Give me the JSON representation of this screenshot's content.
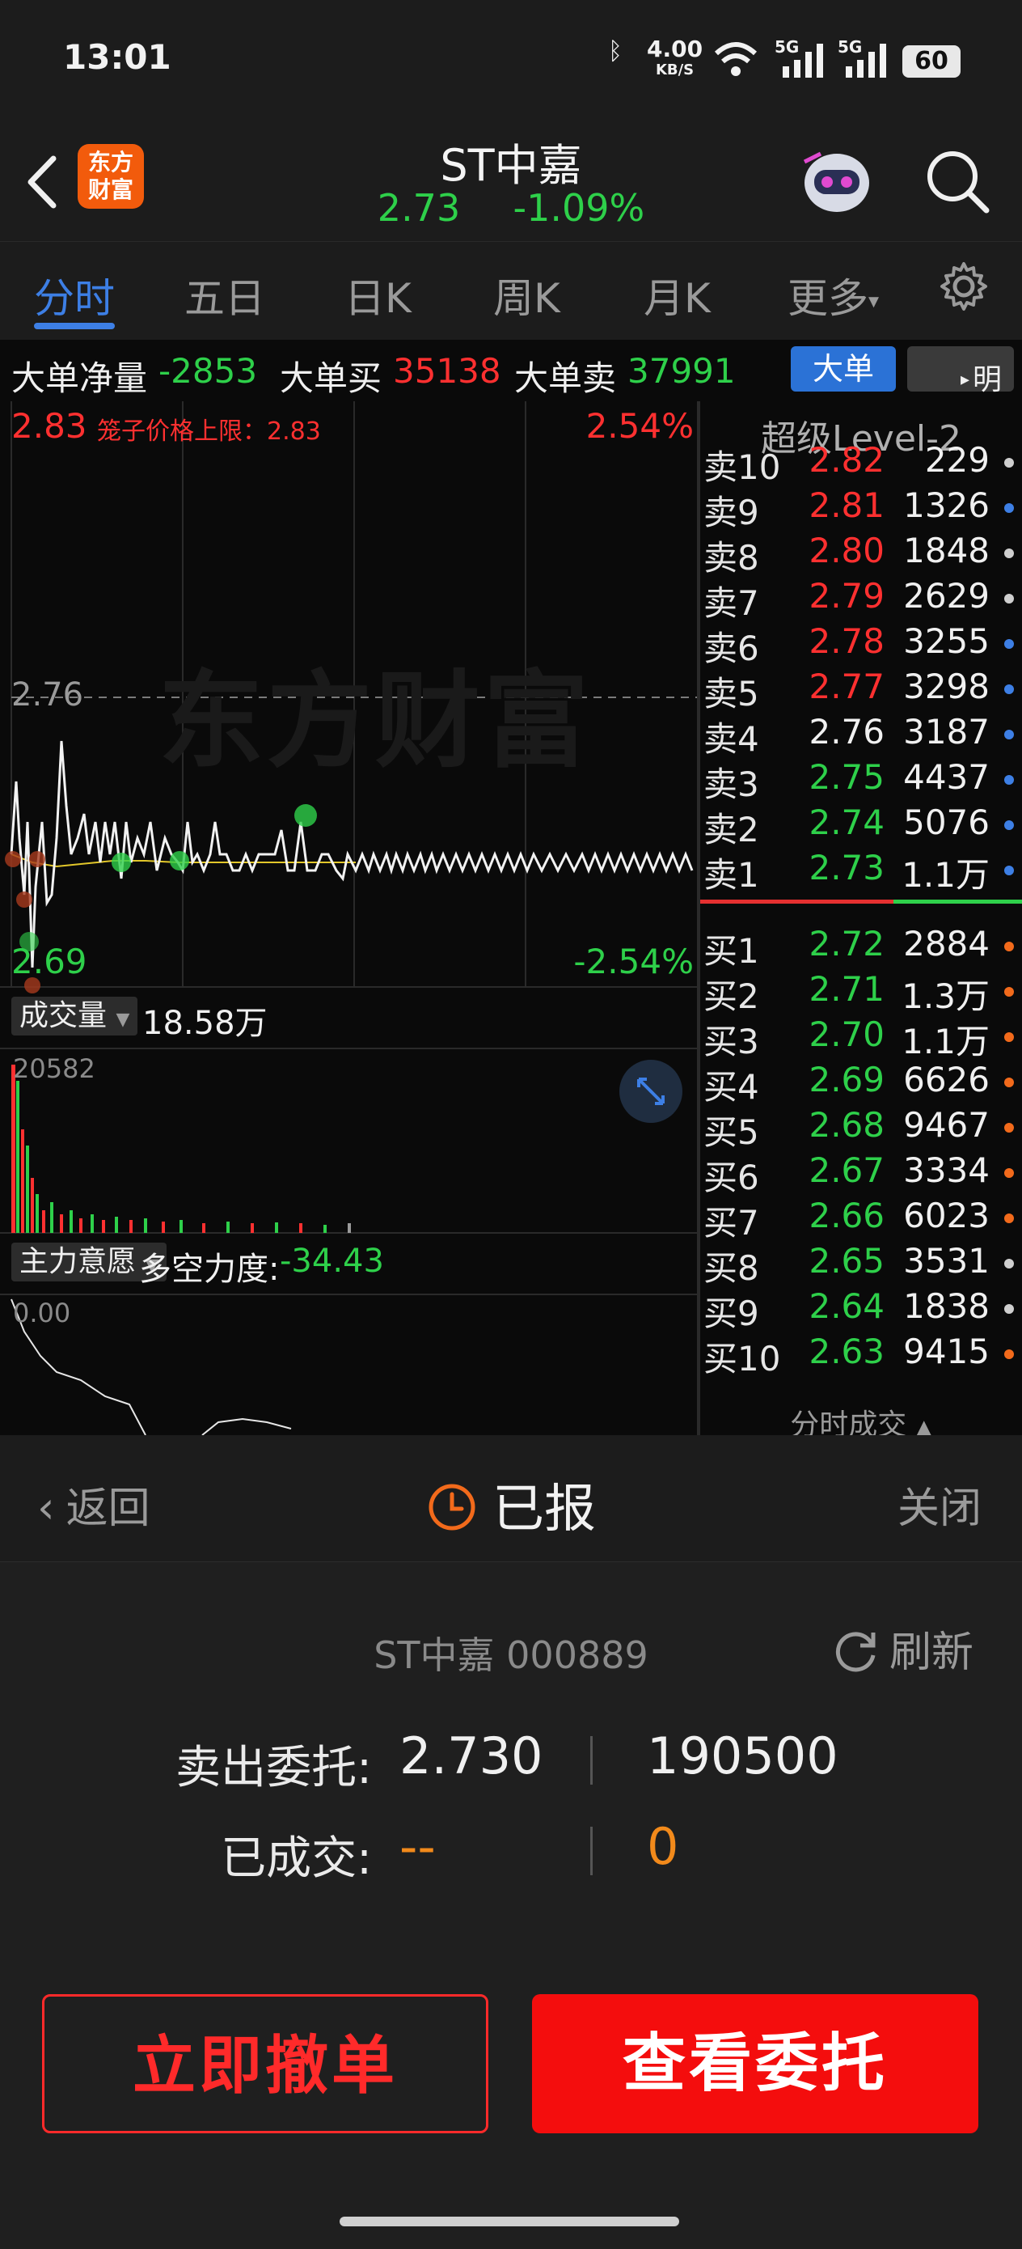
{
  "status_bar": {
    "time": "13:01",
    "net_speed_top": "4.00",
    "net_speed_unit": "KB/S",
    "signal_1_label": "5G",
    "signal_2_label": "5G",
    "battery": "60"
  },
  "header": {
    "logo_line1": "东方",
    "logo_line2": "财富",
    "stock_name": "ST中嘉",
    "price": "2.73",
    "change_pct": "-1.09%"
  },
  "tabs": {
    "items": [
      "分时",
      "五日",
      "日K",
      "周K",
      "月K",
      "更多"
    ],
    "active": "分时"
  },
  "big_order": {
    "net_label": "大单净量",
    "net_value": "-2853",
    "buy_label": "大单买",
    "buy_value": "35138",
    "sell_label": "大单卖",
    "sell_value": "37991",
    "btn_dadan": "大单",
    "btn_mingxi": "明细"
  },
  "chart": {
    "upper_price": "2.83",
    "cage_label": "笼子价格上限：2.83",
    "upper_pct": "2.54%",
    "mid_price": "2.76",
    "lower_price": "2.69",
    "lower_pct": "-2.54%",
    "watermark": "东方财富",
    "volume_label": "成交量",
    "volume_value": "18.58万",
    "volume_max": "20582",
    "indicator_label": "主力意愿",
    "force_label": "多空力度:",
    "force_value": "-34.43",
    "indicator_tick": "0.00"
  },
  "orderbook": {
    "title": "超级Level-2",
    "asks": [
      {
        "label": "卖10",
        "price": "2.82",
        "vol": "229",
        "dot": "#cfcfcf"
      },
      {
        "label": "卖9",
        "price": "2.81",
        "vol": "1326",
        "dot": "#3d7fe5"
      },
      {
        "label": "卖8",
        "price": "2.80",
        "vol": "1848",
        "dot": "#cfcfcf"
      },
      {
        "label": "卖7",
        "price": "2.79",
        "vol": "2629",
        "dot": "#cfcfcf"
      },
      {
        "label": "卖6",
        "price": "2.78",
        "vol": "3255",
        "dot": "#3d7fe5"
      },
      {
        "label": "卖5",
        "price": "2.77",
        "vol": "3298",
        "dot": "#3d7fe5"
      },
      {
        "label": "卖4",
        "price": "2.76",
        "vol": "3187",
        "dot": "#3d7fe5"
      },
      {
        "label": "卖3",
        "price": "2.75",
        "vol": "4437",
        "dot": "#3d7fe5"
      },
      {
        "label": "卖2",
        "price": "2.74",
        "vol": "5076",
        "dot": "#3d7fe5"
      },
      {
        "label": "卖1",
        "price": "2.73",
        "vol": "1.1万",
        "dot": "#3d7fe5"
      }
    ],
    "bids": [
      {
        "label": "买1",
        "price": "2.72",
        "vol": "2884",
        "dot": "#f26a1b"
      },
      {
        "label": "买2",
        "price": "2.71",
        "vol": "1.3万",
        "dot": "#f26a1b"
      },
      {
        "label": "买3",
        "price": "2.70",
        "vol": "1.1万",
        "dot": "#f26a1b"
      },
      {
        "label": "买4",
        "price": "2.69",
        "vol": "6626",
        "dot": "#f26a1b"
      },
      {
        "label": "买5",
        "price": "2.68",
        "vol": "9467",
        "dot": "#f26a1b"
      },
      {
        "label": "买6",
        "price": "2.67",
        "vol": "3334",
        "dot": "#f26a1b"
      },
      {
        "label": "买7",
        "price": "2.66",
        "vol": "6023",
        "dot": "#f26a1b"
      },
      {
        "label": "买8",
        "price": "2.65",
        "vol": "3531",
        "dot": "#cfcfcf"
      },
      {
        "label": "买9",
        "price": "2.64",
        "vol": "1838",
        "dot": "#cfcfcf"
      },
      {
        "label": "买10",
        "price": "2.63",
        "vol": "9415",
        "dot": "#f26a1b"
      }
    ],
    "footer": "分时成交"
  },
  "order_panel": {
    "back_label": "返回",
    "status_title": "已报",
    "close_label": "关闭",
    "stock_code_line": "ST中嘉 000889",
    "refresh_label": "刷新",
    "sell_label": "卖出委托:",
    "sell_price": "2.730",
    "sell_qty": "190500",
    "filled_label": "已成交:",
    "filled_price": "--",
    "filled_qty": "0",
    "cancel_btn": "立即撤单",
    "view_btn": "查看委托"
  },
  "colors": {
    "up_red": "#ff3030",
    "down_green": "#2ed04a",
    "accent_blue": "#3d7fe5",
    "orange": "#f28a1b"
  }
}
